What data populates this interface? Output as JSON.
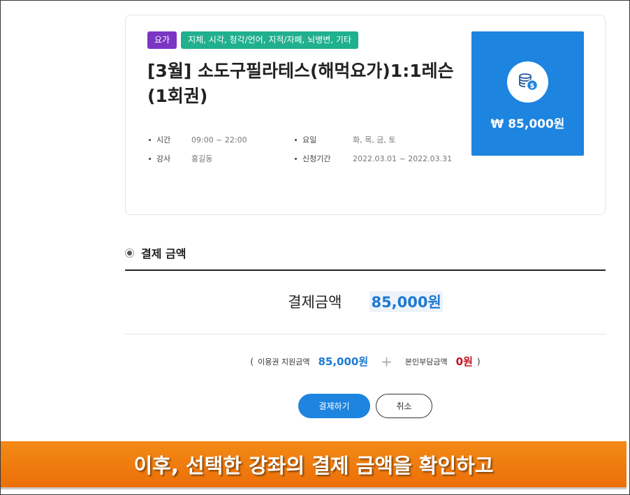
{
  "course": {
    "badge_primary": "요가",
    "badge_categories": "지체, 시각, 청각/언어, 지적/자폐, 뇌병변, 기타",
    "title": "[3월] 소도구필라테스(해먹요가)1:1레슨(1회권)",
    "info": {
      "time_label": "시간",
      "time_value": "09:00 ~ 22:00",
      "instructor_label": "강사",
      "instructor_value": "홍길동",
      "days_label": "요일",
      "days_value": "화, 목, 금, 토",
      "period_label": "신청기간",
      "period_value": "2022.03.01 ~ 2022.03.31"
    },
    "price_text": "₩ 85,000원",
    "price_icon": "coins-icon"
  },
  "payment": {
    "section_title": "결제 금액",
    "total_label": "결제금액",
    "total_value": "85,000원",
    "breakdown": {
      "open_paren": "(",
      "voucher_label": "이용권 지원금액",
      "voucher_value": "85,000원",
      "plus_sign": "+",
      "self_label": "본인부담금액",
      "self_value": "0원",
      "close_paren": ")"
    },
    "pay_button": "결제하기",
    "cancel_button": "취소"
  },
  "caption": {
    "text": "이후, 선택한 강좌의 결제 금액을 확인하고"
  },
  "colors": {
    "accent_blue": "#1d84e0",
    "badge_purple": "#7b35c4",
    "badge_green": "#20b08e",
    "self_pay_red": "#c4131e",
    "caption_orange": "#ec6f08"
  }
}
